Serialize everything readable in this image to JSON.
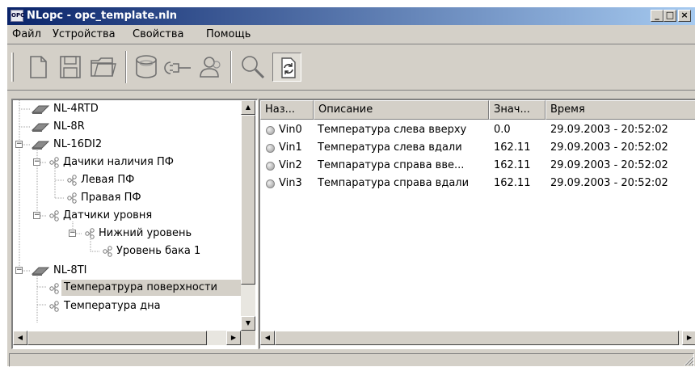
{
  "window": {
    "app_icon_text": "OPC",
    "title": "NLopc - opc_template.nln",
    "minimize": "_",
    "maximize": "□",
    "close": "×"
  },
  "menu": [
    "Файл",
    "Устройства",
    "Свойства",
    "Помощь"
  ],
  "toolbar": {
    "buttons": [
      "new-file",
      "save",
      "open-folder",
      "database",
      "connect-plug",
      "users",
      "search",
      "refresh"
    ],
    "pressed": "refresh"
  },
  "tree": {
    "items": [
      {
        "label": "NL-4RTD",
        "kind": "device",
        "level": 0
      },
      {
        "label": "NL-8R",
        "kind": "device",
        "level": 0
      },
      {
        "label": "NL-16DI2",
        "kind": "device",
        "level": 0,
        "expanded": true
      },
      {
        "label": "Дачики наличия ПФ",
        "kind": "group",
        "level": 1,
        "expanded": true
      },
      {
        "label": "Левая ПФ",
        "kind": "tag",
        "level": 2
      },
      {
        "label": "Правая ПФ",
        "kind": "tag",
        "level": 2
      },
      {
        "label": "Датчики уровня",
        "kind": "group",
        "level": 1,
        "expanded": true
      },
      {
        "label": "Нижний уровень",
        "kind": "group",
        "level": 2,
        "expanded": true
      },
      {
        "label": "Уровень бака 1",
        "kind": "tag",
        "level": 3
      },
      {
        "label": "NL-8TI",
        "kind": "device",
        "level": 0,
        "expanded": true
      },
      {
        "label": "Температрура поверхности",
        "kind": "tag",
        "level": 1,
        "selected": true
      },
      {
        "label": "Температура дна",
        "kind": "tag",
        "level": 1
      }
    ]
  },
  "list": {
    "columns": [
      "Наз...",
      "Описание",
      "Знач...",
      "Время"
    ],
    "rows": [
      {
        "name": "Vin0",
        "description": "Температура слева вверху",
        "value": "0.0",
        "time": "29.09.2003 - 20:52:02"
      },
      {
        "name": "Vin1",
        "description": "Температура слева вдали",
        "value": "162.11",
        "time": "29.09.2003 - 20:52:02"
      },
      {
        "name": "Vin2",
        "description": "Темпаратура справа вве...",
        "value": "162.11",
        "time": "29.09.2003 - 20:52:02"
      },
      {
        "name": "Vin3",
        "description": "Темпаратура справа вдали",
        "value": "162.11",
        "time": "29.09.2003 - 20:52:02"
      }
    ]
  },
  "status": {
    "text": ""
  }
}
